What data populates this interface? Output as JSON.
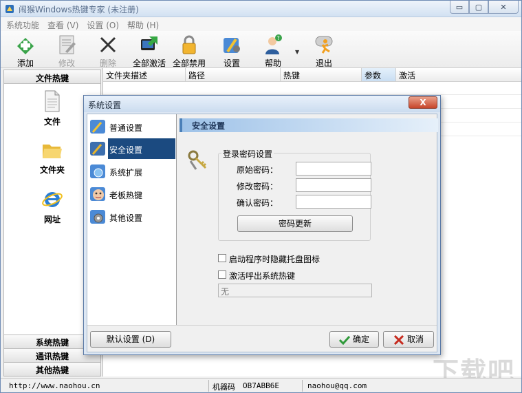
{
  "window": {
    "title": "闹猴Windows热键专家 (未注册)",
    "controls": {
      "minimize": "▭",
      "maximize": "▢",
      "close": "✕"
    }
  },
  "menu": [
    "系统功能",
    "查看 (V)",
    "设置 (O)",
    "帮助 (H)"
  ],
  "toolbar": {
    "add": "添加",
    "modify": "修改",
    "delete": "删除",
    "activate_all": "全部激活",
    "disable_all": "全部禁用",
    "settings": "设置",
    "help": "帮助",
    "exit": "退出"
  },
  "left_panel": {
    "header": "文件热键",
    "items": [
      "文件",
      "文件夹",
      "网址"
    ],
    "bottom_tabs": [
      "系统热键",
      "通讯热键",
      "其他热键"
    ]
  },
  "grid": {
    "columns": [
      "文件夹描述",
      "路径",
      "热键",
      "参数",
      "激活"
    ]
  },
  "status_bar": {
    "website": "http://www.naohou.cn",
    "machine_code_label": "机器码",
    "machine_code": "OB7ABB6E",
    "email": "naohou@qq.com"
  },
  "watermark": "下载吧",
  "dialog": {
    "title": "系统设置",
    "close": "X",
    "nav": [
      "普通设置",
      "安全设置",
      "系统扩展",
      "老板热键",
      "其他设置"
    ],
    "section_title": "安全设置",
    "password_group": {
      "legend": "登录密码设置",
      "original_label": "原始密码：",
      "modify_label": "修改密码：",
      "confirm_label": "确认密码：",
      "original_value": "",
      "modify_value": "",
      "confirm_value": "",
      "update_button": "密码更新"
    },
    "options": {
      "hide_tray": "启动程序时隐藏托盘图标",
      "activate_hotkey": "激活呼出系统热键",
      "hotkey_value": "无"
    },
    "footer": {
      "default_button": "默认设置 (D)",
      "ok_button": "确定",
      "cancel_button": "取消"
    }
  },
  "colors": {
    "nav_selected": "#1b4a80",
    "section_bar": "#9ec2e8",
    "dialog_frame": "#dde7f3"
  }
}
